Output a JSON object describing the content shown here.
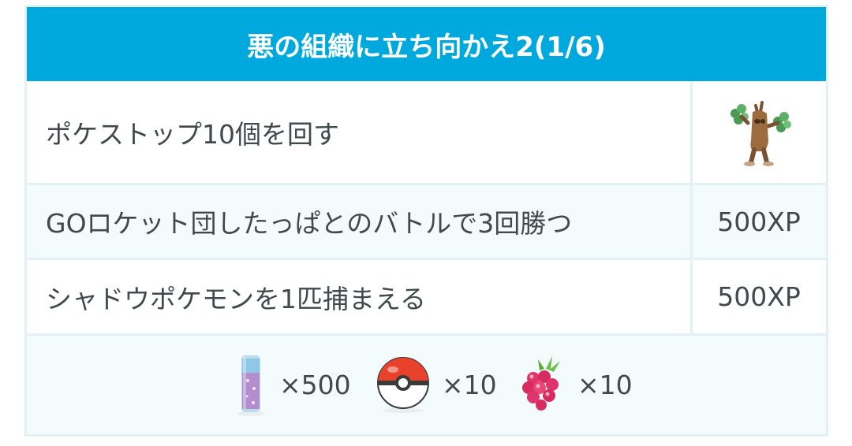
{
  "research": {
    "title": "悪の組織に立ち向かえ2(1/6)",
    "accent_color": "#00a9dd",
    "tasks": [
      {
        "label": "ポケストップ10個を回す",
        "reward_type": "pokemon",
        "reward_icon": "sudowoodo-icon"
      },
      {
        "label": "GOロケット団したっぱとのバトルで3回勝つ",
        "reward_type": "text",
        "reward": "500XP"
      },
      {
        "label": "シャドウポケモンを1匹捕まえる",
        "reward_type": "text",
        "reward": "500XP"
      }
    ],
    "completion_rewards": [
      {
        "icon": "stardust-icon",
        "quantity": "×500"
      },
      {
        "icon": "poke-ball-icon",
        "quantity": "×10"
      },
      {
        "icon": "razz-berry-icon",
        "quantity": "×10"
      }
    ]
  }
}
